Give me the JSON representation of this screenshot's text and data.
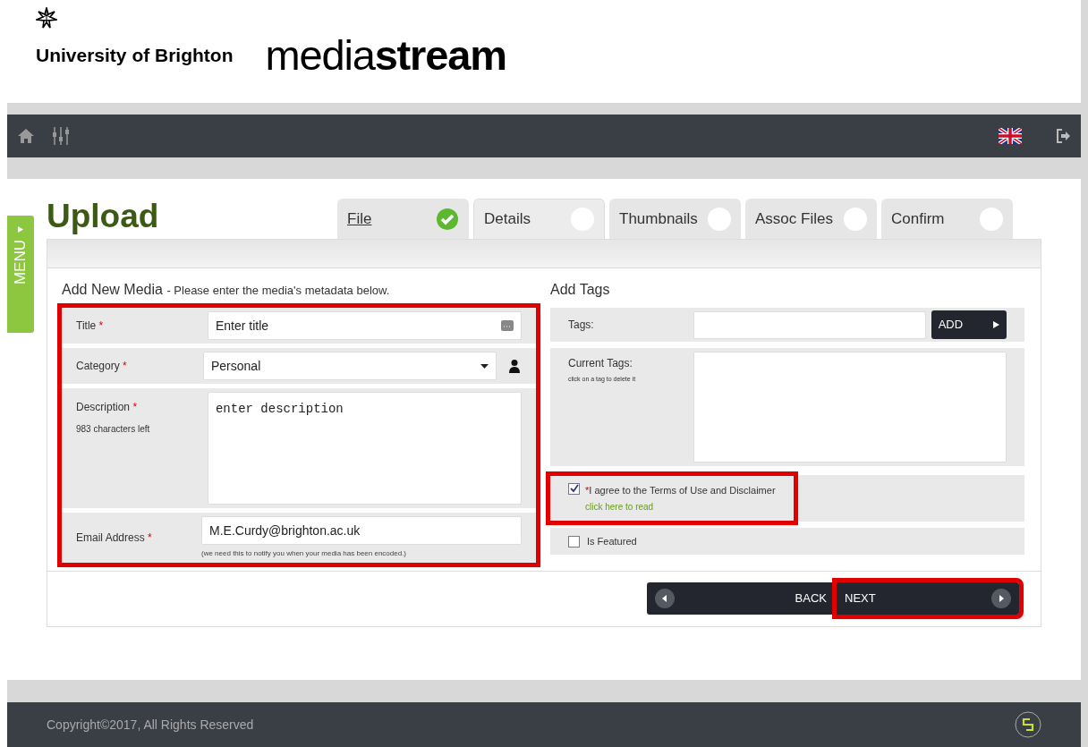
{
  "header": {
    "institution": "University of Brighton",
    "product_light": "media",
    "product_bold": "stream"
  },
  "menu_tab": {
    "label": "MENU"
  },
  "page_title": "Upload",
  "steps": [
    {
      "label": "File",
      "done": true,
      "selected": false
    },
    {
      "label": "Details",
      "done": false,
      "selected": true
    },
    {
      "label": "Thumbnails",
      "done": false,
      "selected": false
    },
    {
      "label": "Assoc Files",
      "done": false,
      "selected": false
    },
    {
      "label": "Confirm",
      "done": false,
      "selected": false
    }
  ],
  "media_form": {
    "heading": "Add New Media",
    "subheading": "- Please enter the media's metadata below.",
    "highlighted": true,
    "fields": [
      {
        "kind": "text",
        "label": "Title",
        "required_mark": "*",
        "value": "Enter title"
      },
      {
        "kind": "select",
        "label": "Category",
        "required_mark": "*",
        "value": "Personal"
      },
      {
        "kind": "textarea",
        "label": "Description",
        "required_mark": "*",
        "hint": "983 characters left",
        "value": "enter description"
      },
      {
        "kind": "email",
        "label": "Email Address",
        "required_mark": "*",
        "value": "M.E.Curdy@brighton.ac.uk",
        "note": "(we need this to notify you when your media has been encoded.)"
      }
    ]
  },
  "tags": {
    "heading": "Add Tags",
    "tags_label": "Tags:",
    "add_button": "ADD",
    "current_label": "Current Tags:",
    "current_hint": "click on a tag to delete it"
  },
  "agree": {
    "required_mark": "*",
    "text": "I agree to the Terms of Use and Disclaimer",
    "link": "click here to read",
    "checked": true,
    "highlighted": true
  },
  "featured": {
    "text": "Is Featured",
    "checked": false
  },
  "nav": {
    "back": "BACK",
    "next": "NEXT",
    "next_highlighted": true
  },
  "footer": {
    "copyright": "Copyright©2017, All Rights Reserved"
  }
}
